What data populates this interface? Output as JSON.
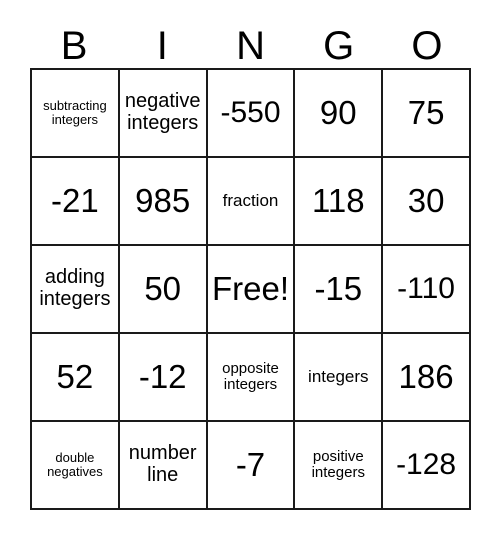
{
  "card": {
    "header_letters": [
      "B",
      "I",
      "N",
      "G",
      "O"
    ],
    "rows": [
      [
        {
          "text": "subtracting integers",
          "size": "xxs"
        },
        {
          "text": "negative integers",
          "size": "md"
        },
        {
          "text": "-550",
          "size": "lg"
        },
        {
          "text": "90",
          "size": "xl"
        },
        {
          "text": "75",
          "size": "xl"
        }
      ],
      [
        {
          "text": "-21",
          "size": "xl"
        },
        {
          "text": "985",
          "size": "xl"
        },
        {
          "text": "fraction",
          "size": "sm"
        },
        {
          "text": "118",
          "size": "xl"
        },
        {
          "text": "30",
          "size": "xl"
        }
      ],
      [
        {
          "text": "adding integers",
          "size": "md"
        },
        {
          "text": "50",
          "size": "xl"
        },
        {
          "text": "Free!",
          "size": "xl"
        },
        {
          "text": "-15",
          "size": "xl"
        },
        {
          "text": "-110",
          "size": "lg"
        }
      ],
      [
        {
          "text": "52",
          "size": "xl"
        },
        {
          "text": "-12",
          "size": "xl"
        },
        {
          "text": "opposite integers",
          "size": "xs"
        },
        {
          "text": "integers",
          "size": "sm"
        },
        {
          "text": "186",
          "size": "xl"
        }
      ],
      [
        {
          "text": "double negatives",
          "size": "xxs"
        },
        {
          "text": "number line",
          "size": "md"
        },
        {
          "text": "-7",
          "size": "xl"
        },
        {
          "text": "positive integers",
          "size": "xs"
        },
        {
          "text": "-128",
          "size": "lg"
        }
      ]
    ]
  }
}
